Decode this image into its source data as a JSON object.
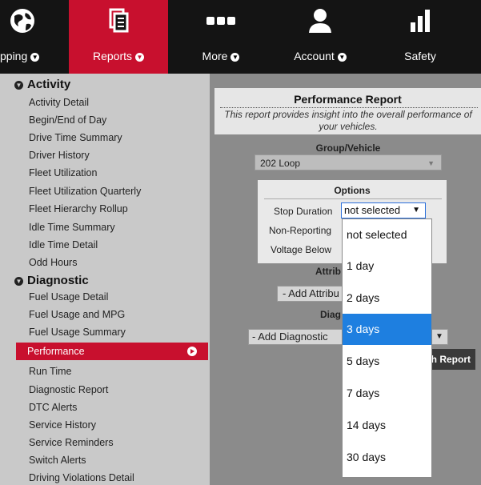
{
  "nav": {
    "items": [
      {
        "label": "pping",
        "icon": "globe-icon"
      },
      {
        "label": "Reports",
        "icon": "document-icon"
      },
      {
        "label": "More",
        "icon": "more-dots-icon"
      },
      {
        "label": "Account",
        "icon": "user-icon"
      },
      {
        "label": "Safety",
        "icon": "bar-chart-icon"
      }
    ],
    "active": "Reports",
    "accent_color": "#c8102e"
  },
  "sidebar": {
    "categories": [
      {
        "label": "Activity",
        "items": [
          "Activity Detail",
          "Begin/End of Day",
          "Drive Time Summary",
          "Driver History",
          "Fleet Utilization",
          "Fleet Utilization Quarterly",
          "Fleet Hierarchy Rollup",
          "Idle Time Summary",
          "Idle Time Detail",
          "Odd Hours"
        ]
      },
      {
        "label": "Diagnostic",
        "items": [
          "Fuel Usage Detail",
          "Fuel Usage and MPG",
          "Fuel Usage Summary",
          "Performance",
          "Run Time",
          "Diagnostic Report",
          "DTC Alerts",
          "Service History",
          "Service Reminders",
          "Switch Alerts",
          "Driving Violations Detail"
        ]
      }
    ],
    "active_item": "Performance"
  },
  "report": {
    "title": "Performance Report",
    "description": "This report provides insight into the overall performance of your vehicles.",
    "group_label": "Group/Vehicle",
    "group_value": "202 Loop",
    "options_title": "Options",
    "stop_duration_label": "Stop Duration",
    "stop_duration_value": "not selected",
    "non_reporting_label": "Non-Reporting",
    "voltage_label": "Voltage Below",
    "attributes_label": "Attrib",
    "add_attribute": "- Add Attribu",
    "diagnostics_label": "Diag",
    "add_diagnostic": "- Add Diagnostic",
    "generate_label": "h Report"
  },
  "dropdown": {
    "options": [
      "not selected",
      "1 day",
      "2 days",
      "3 days",
      "5 days",
      "7 days",
      "14 days",
      "30 days"
    ],
    "highlighted": "3 days",
    "highlight_color": "#1e7fe0"
  }
}
